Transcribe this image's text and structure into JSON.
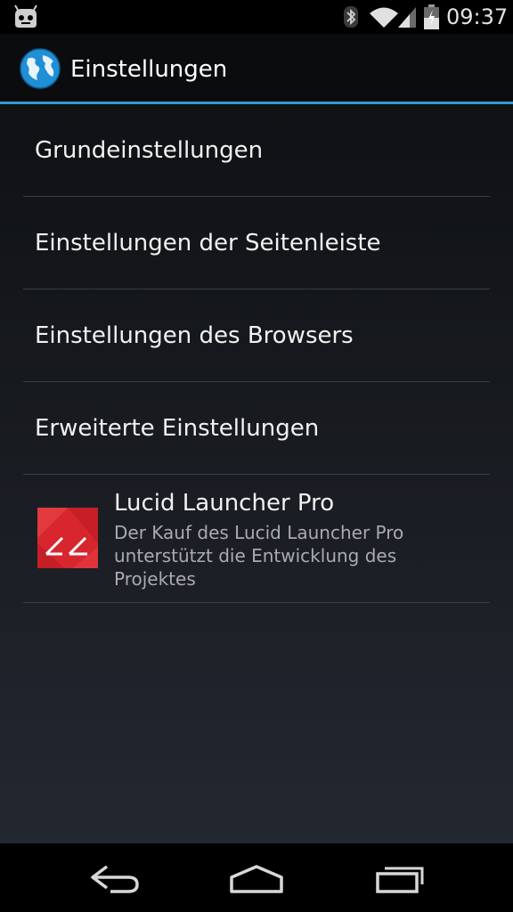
{
  "status_bar": {
    "time": "09:37",
    "icons": [
      "cyanogenmod-icon",
      "bluetooth-icon",
      "wifi-icon",
      "signal-icon",
      "battery-charging-icon"
    ]
  },
  "action_bar": {
    "title": "Einstellungen",
    "icon": "globe-icon"
  },
  "preferences": {
    "items": [
      {
        "label": "Grundeinstellungen"
      },
      {
        "label": "Einstellungen der Seitenleiste"
      },
      {
        "label": "Einstellungen des Browsers"
      },
      {
        "label": "Erweiterte Einstellungen"
      }
    ],
    "promo": {
      "title": "Lucid Launcher Pro",
      "summary": "Der Kauf des Lucid Launcher Pro unterstützt die Entwicklung des Projektes",
      "icon": "lucid-launcher-icon"
    }
  },
  "nav_bar": {
    "buttons": [
      "back-icon",
      "home-icon",
      "recents-icon"
    ]
  },
  "colors": {
    "accent": "#2f9bd0",
    "promo_icon": "#d8262e",
    "background": "#0f1114"
  }
}
